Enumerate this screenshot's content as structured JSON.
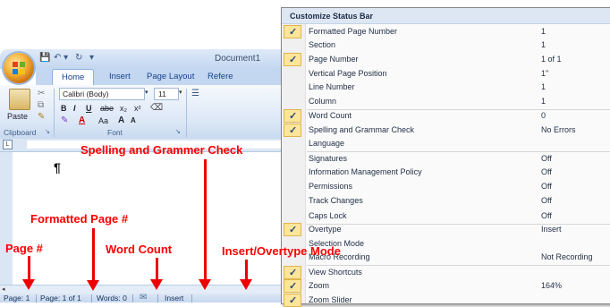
{
  "word": {
    "doc_title": "Document1",
    "tabs": [
      "Home",
      "Insert",
      "Page Layout",
      "Refere"
    ],
    "font_name": "Calibri (Body)",
    "font_size": "11",
    "paste_label": "Paste",
    "groups": {
      "clipboard": "Clipboard",
      "font": "Font"
    },
    "format_buttons": {
      "bold": "B",
      "italic": "I",
      "underline": "U",
      "strike": "abe",
      "sub": "x₂",
      "sup": "x²",
      "change_case": "Aa",
      "grow": "A",
      "shrink": "A"
    },
    "status": {
      "page": "Page: 1",
      "formatted_page": "Page: 1 of 1",
      "words": "Words: 0",
      "insert": "Insert"
    }
  },
  "menu": {
    "title": "Customize Status Bar",
    "items": [
      {
        "label": "Formatted Page Number",
        "value": "1",
        "checked": true
      },
      {
        "label": "Section",
        "value": "1",
        "checked": false
      },
      {
        "label": "Page Number",
        "value": "1 of 1",
        "checked": true
      },
      {
        "label": "Vertical Page Position",
        "value": "1\"",
        "checked": false
      },
      {
        "label": "Line Number",
        "value": "1",
        "checked": false
      },
      {
        "label": "Column",
        "value": "1",
        "checked": false
      },
      {
        "label": "Word Count",
        "value": "0",
        "checked": true
      },
      {
        "label": "Spelling and Grammar Check",
        "value": "No Errors",
        "checked": true
      },
      {
        "label": "Language",
        "value": "",
        "checked": false
      },
      {
        "label": "Signatures",
        "value": "Off",
        "checked": false
      },
      {
        "label": "Information Management Policy",
        "value": "Off",
        "checked": false
      },
      {
        "label": "Permissions",
        "value": "Off",
        "checked": false
      },
      {
        "label": "Track Changes",
        "value": "Off",
        "checked": false
      },
      {
        "label": "Caps Lock",
        "value": "Off",
        "checked": false
      },
      {
        "label": "Overtype",
        "value": "Insert",
        "checked": true
      },
      {
        "label": "Selection Mode",
        "value": "",
        "checked": false
      },
      {
        "label": "Macro Recording",
        "value": "Not Recording",
        "checked": false
      },
      {
        "label": "View Shortcuts",
        "value": "",
        "checked": true
      },
      {
        "label": "Zoom",
        "value": "164%",
        "checked": true
      },
      {
        "label": "Zoom Slider",
        "value": "",
        "checked": true
      }
    ]
  },
  "annotations": {
    "spelling": "Spelling and Grammer Check",
    "formatted": "Formatted Page #",
    "page": "Page #",
    "word_count": "Word Count",
    "insert": "Insert/Overtype Mode"
  },
  "colors": {
    "annotation": "#ff0000",
    "check_bg": "#fde59a",
    "ribbon": "#dbe7f6"
  }
}
